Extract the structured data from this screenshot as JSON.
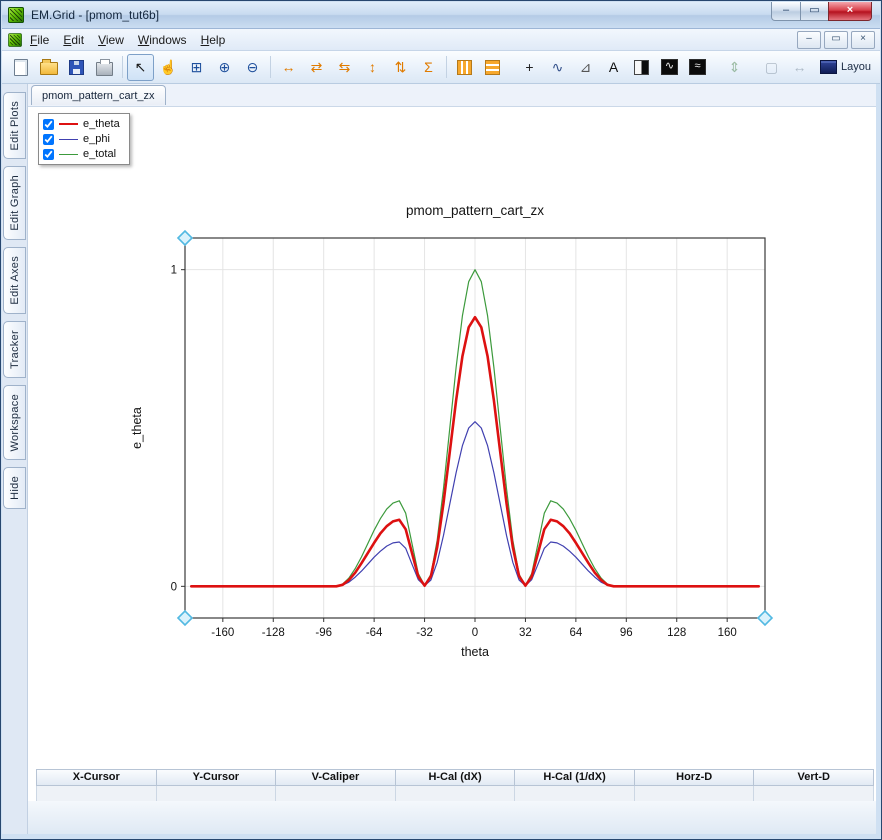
{
  "window": {
    "title": "EM.Grid - [pmom_tut6b]",
    "controls": {
      "minimize": "–",
      "maximize": "▭",
      "close": "×"
    }
  },
  "menubar": {
    "items": [
      {
        "label": "File"
      },
      {
        "label": "Edit"
      },
      {
        "label": "View"
      },
      {
        "label": "Windows"
      },
      {
        "label": "Help"
      }
    ],
    "mdi": {
      "minimize": "–",
      "restore": "▭",
      "close": "×"
    }
  },
  "toolbar": {
    "items": [
      {
        "name": "new-file-button",
        "kind": "page"
      },
      {
        "name": "open-button",
        "kind": "folder"
      },
      {
        "name": "save-button",
        "kind": "floppy"
      },
      {
        "name": "print-button",
        "kind": "printer"
      },
      {
        "kind": "sep"
      },
      {
        "name": "select-tool-button",
        "glyph": "↖",
        "color": "#1a1a1a",
        "state": "selected"
      },
      {
        "name": "pan-tool-button",
        "glyph": "☝",
        "color": "#7a5c2e"
      },
      {
        "name": "zoom-window-button",
        "glyph": "⊞",
        "color": "#1e4f9c"
      },
      {
        "name": "zoom-in-button",
        "glyph": "⊕",
        "color": "#1e4f9c"
      },
      {
        "name": "zoom-out-button",
        "glyph": "⊖",
        "color": "#1e4f9c"
      },
      {
        "kind": "sep"
      },
      {
        "name": "fit-width-button",
        "glyph": "↔",
        "color": "#e07b00"
      },
      {
        "name": "expand-horizontal-button",
        "glyph": "⇄",
        "color": "#e07b00"
      },
      {
        "name": "shrink-horizontal-button",
        "glyph": "⇆",
        "color": "#e07b00"
      },
      {
        "name": "fit-height-button",
        "glyph": "↕",
        "color": "#e07b00"
      },
      {
        "name": "expand-vertical-button",
        "glyph": "⇅",
        "color": "#e07b00"
      },
      {
        "name": "autoscale-button",
        "glyph": "Σ",
        "color": "#e07b00"
      },
      {
        "kind": "sep"
      },
      {
        "name": "vertical-stripes-button",
        "kind": "cols"
      },
      {
        "name": "horizontal-stripes-button",
        "kind": "rows"
      },
      {
        "kind": "gap"
      },
      {
        "name": "crosshair-button",
        "glyph": "+",
        "color": "#222"
      },
      {
        "name": "curve-axes-button",
        "glyph": "∿",
        "color": "#33508a"
      },
      {
        "name": "caliper-button",
        "glyph": "⊿",
        "color": "#555555"
      },
      {
        "name": "text-annotation-button",
        "glyph": "A",
        "color": "#111111"
      },
      {
        "name": "plot-style-button",
        "kind": "halfblack"
      },
      {
        "name": "waveform-button",
        "kind": "blackwave",
        "glyph": "∿"
      },
      {
        "name": "waveform-multi-button",
        "kind": "blackwave",
        "glyph": "≈"
      },
      {
        "kind": "gap"
      },
      {
        "name": "fit-page-disabled-button",
        "glyph": "⇕",
        "color": "#3c7a3c",
        "state": "disabled"
      },
      {
        "kind": "gap"
      },
      {
        "name": "select-region-disabled-button",
        "glyph": "▢",
        "color": "#667788",
        "state": "disabled"
      },
      {
        "name": "measure-disabled-button",
        "glyph": "↔",
        "color": "#667788",
        "state": "disabled"
      },
      {
        "kind": "spacer"
      },
      {
        "name": "layout-select",
        "kind": "layout",
        "label": "Layou"
      }
    ]
  },
  "sidebar": {
    "tabs": [
      {
        "label": "Edit Plots"
      },
      {
        "label": "Edit Graph"
      },
      {
        "label": "Edit Axes"
      },
      {
        "label": "Tracker"
      },
      {
        "label": "Workspace"
      },
      {
        "label": "Hide"
      }
    ]
  },
  "document": {
    "tab_label": "pmom_pattern_cart_zx"
  },
  "legend": {
    "items": [
      {
        "label": "e_theta",
        "color": "#dd1111",
        "checked": true,
        "line_width": 2.5
      },
      {
        "label": "e_phi",
        "color": "#4040b0",
        "checked": true,
        "line_width": 1.5
      },
      {
        "label": "e_total",
        "color": "#3c9a3c",
        "checked": true,
        "line_width": 1.5
      }
    ]
  },
  "chart_data": {
    "type": "line",
    "title": "pmom_pattern_cart_zx",
    "xlabel": "theta",
    "ylabel": "e_theta",
    "xlim": [
      -184,
      184
    ],
    "ylim": [
      -0.1,
      1.1
    ],
    "xticks": [
      -160,
      -128,
      -96,
      -64,
      -32,
      0,
      32,
      64,
      96,
      128,
      160
    ],
    "yticks": [
      0,
      1
    ],
    "grid": true,
    "legend_position": "top-left-floating",
    "handle_color": "#52b9e2",
    "handles": [
      "top-left",
      "bottom-left",
      "bottom-right"
    ],
    "x": [
      -180,
      -92,
      -88,
      -84,
      -80,
      -76,
      -72,
      -68,
      -64,
      -60,
      -56,
      -52,
      -48,
      -44,
      -40,
      -36,
      -32,
      -28,
      -24,
      -20,
      -16,
      -12,
      -8,
      -4,
      0,
      4,
      8,
      12,
      16,
      20,
      24,
      28,
      32,
      36,
      40,
      44,
      48,
      52,
      56,
      60,
      64,
      68,
      72,
      76,
      80,
      84,
      88,
      92,
      180
    ],
    "series": [
      {
        "name": "e_theta",
        "color": "#dd1111",
        "width": 2.6,
        "values": [
          0,
          0,
          0,
          0.005,
          0.02,
          0.043,
          0.073,
          0.105,
          0.137,
          0.167,
          0.19,
          0.205,
          0.21,
          0.18,
          0.105,
          0.031,
          0.002,
          0.032,
          0.124,
          0.263,
          0.425,
          0.587,
          0.726,
          0.818,
          0.85,
          0.818,
          0.726,
          0.587,
          0.425,
          0.263,
          0.124,
          0.032,
          0.002,
          0.031,
          0.105,
          0.18,
          0.21,
          0.205,
          0.19,
          0.167,
          0.137,
          0.105,
          0.073,
          0.043,
          0.02,
          0.005,
          0,
          0,
          0
        ]
      },
      {
        "name": "e_phi",
        "color": "#4040b0",
        "width": 1.2,
        "values": [
          0,
          0,
          0,
          0.004,
          0.013,
          0.029,
          0.048,
          0.07,
          0.092,
          0.111,
          0.127,
          0.137,
          0.14,
          0.12,
          0.07,
          0.021,
          0.002,
          0.02,
          0.076,
          0.161,
          0.26,
          0.359,
          0.444,
          0.5,
          0.52,
          0.5,
          0.444,
          0.359,
          0.26,
          0.161,
          0.076,
          0.02,
          0.002,
          0.021,
          0.07,
          0.12,
          0.14,
          0.137,
          0.127,
          0.111,
          0.092,
          0.07,
          0.048,
          0.029,
          0.013,
          0.004,
          0,
          0,
          0
        ]
      },
      {
        "name": "e_total",
        "color": "#3c9a3c",
        "width": 1.2,
        "values": [
          0,
          0,
          0,
          0.007,
          0.026,
          0.056,
          0.093,
          0.135,
          0.177,
          0.214,
          0.244,
          0.263,
          0.27,
          0.231,
          0.135,
          0.04,
          0.003,
          0.038,
          0.146,
          0.309,
          0.5,
          0.691,
          0.854,
          0.962,
          1.0,
          0.962,
          0.854,
          0.691,
          0.5,
          0.309,
          0.146,
          0.038,
          0.003,
          0.04,
          0.135,
          0.231,
          0.27,
          0.263,
          0.244,
          0.214,
          0.177,
          0.135,
          0.093,
          0.056,
          0.026,
          0.007,
          0,
          0,
          0
        ]
      }
    ]
  },
  "status_table": {
    "columns": [
      "X-Cursor",
      "Y-Cursor",
      "V-Caliper",
      "H-Cal (dX)",
      "H-Cal (1/dX)",
      "Horz-D",
      "Vert-D"
    ]
  }
}
